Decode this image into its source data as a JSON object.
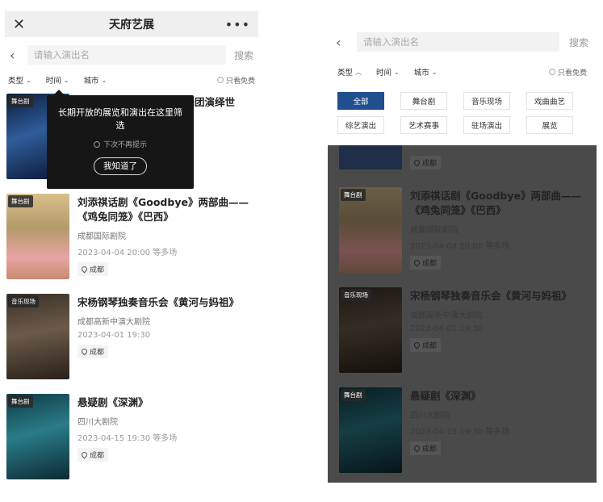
{
  "left": {
    "close_icon": "close-icon",
    "title": "天府艺展",
    "more_icon": "more-icon",
    "search_placeholder": "请输入演出名",
    "search_button": "搜索",
    "filters": [
      "类型",
      "时间",
      "城市"
    ],
    "free_only": "只看免费",
    "tooltip": {
      "text": "长期开放的展览和演出在这里筛选",
      "dont_remind": "下次不再提示",
      "button": "我知道了"
    },
    "first_item_title_visible": "蕾舞团演绎世",
    "items": [
      {
        "tag": "舞台剧",
        "title": "刘添祺话剧《Goodbye》两部曲——《鸡兔同笼》《巴西》",
        "venue": "成都国际剧院",
        "time": "2023-04-04 20:00 等多场",
        "city": "成都"
      },
      {
        "tag": "音乐现场",
        "title": "宋杨钢琴独奏音乐会《黄河与妈祖》",
        "venue": "成都高新中演大剧院",
        "time": "2023-04-01 19:30",
        "city": "成都"
      },
      {
        "tag": "舞台剧",
        "title": "悬疑剧《深渊》",
        "venue": "四川大剧院",
        "time": "2023-04-15 19:30 等多场",
        "city": "成都"
      }
    ],
    "first_item_tag": "舞台剧"
  },
  "right": {
    "search_placeholder": "请输入演出名",
    "search_button": "搜索",
    "filters": [
      "类型",
      "时间",
      "城市"
    ],
    "free_only": "只看免费",
    "categories": [
      "全部",
      "舞台剧",
      "音乐现场",
      "戏曲曲艺",
      "综艺演出",
      "艺术赛事",
      "驻场演出",
      "展览"
    ],
    "active_category": "全部",
    "partial_city": "成都",
    "items": [
      {
        "tag": "舞台剧",
        "title": "刘添祺话剧《Goodbye》两部曲——《鸡兔同笼》《巴西》",
        "venue": "成都国际剧院",
        "time": "2023-04-04 20:00 等多场",
        "city": "成都"
      },
      {
        "tag": "音乐现场",
        "title": "宋杨钢琴独奏音乐会《黄河与妈祖》",
        "venue": "成都高新中演大剧院",
        "time": "2023-04-01 19:30",
        "city": "成都"
      },
      {
        "tag": "舞台剧",
        "title": "悬疑剧《深渊》",
        "venue": "四川大剧院",
        "time": "2023-04-15 19:30 等多场",
        "city": "成都"
      }
    ]
  },
  "colors": {
    "accent": "#1f4f8f",
    "tooltip_bg": "#161616",
    "mask": "#4a4a4a"
  }
}
